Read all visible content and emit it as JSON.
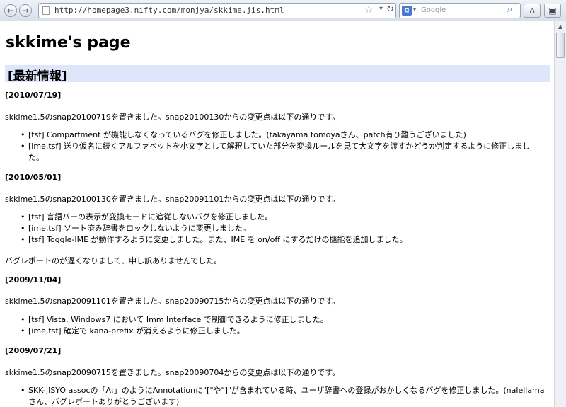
{
  "browser": {
    "url": "http://homepage3.nifty.com/monjya/skkime.jis.html",
    "search_placeholder": "Google",
    "back_label": "←",
    "forward_label": "→"
  },
  "page": {
    "title": "skkime's page",
    "section_title": "[最新情報]",
    "entries": [
      {
        "date": "[2010/07/19]",
        "intro": "skkime1.5のsnap20100719を置きました。snap20100130からの変更点は以下の通りです。",
        "items": [
          "[tsf] Compartment が機能しなくなっているバグを修正しました。(takayama tomoyaさん、patch有り難うございました)",
          "[ime,tsf] 送り仮名に続くアルファベットを小文字として解釈していた部分を変換ルールを見て大文字を渡すかどうか判定するように修正しました。"
        ]
      },
      {
        "date": "[2010/05/01]",
        "intro": "skkime1.5のsnap20100130を置きました。snap20091101からの変更点は以下の通りです。",
        "items": [
          "[tsf] 言語バーの表示が変換モードに追従しないバグを修正しました。",
          "[ime,tsf] ソート済み辞書をロックしないように変更しました。",
          "[tsf] Toggle-IME が動作するように変更しました。また、IME を on/off にするだけの機能を追加しました。"
        ],
        "note": "バグレポートのが遅くなりまして、申し訳ありませんでした。"
      },
      {
        "date": "[2009/11/04]",
        "intro": "skkime1.5のsnap20091101を置きました。snap20090715からの変更点は以下の通りです。",
        "items": [
          "[tsf] Vista, Windows7 において Imm Interface で制御できるように修正しました。",
          "[ime,tsf] 確定で kana-prefix が消えるように修正しました。"
        ]
      },
      {
        "date": "[2009/07/21]",
        "intro": "skkime1.5のsnap20090715を置きました。snap20090704からの変更点は以下の通りです。",
        "items": [
          "SKK-JISYO assocの「A;」のようにAnnotationに\"[\"や\"]\"が含まれている時、ユーザ辞書への登録がおかしくなるバグを修正しました。(nalellamaさん、バグレポートありがとうございます)"
        ]
      }
    ]
  }
}
